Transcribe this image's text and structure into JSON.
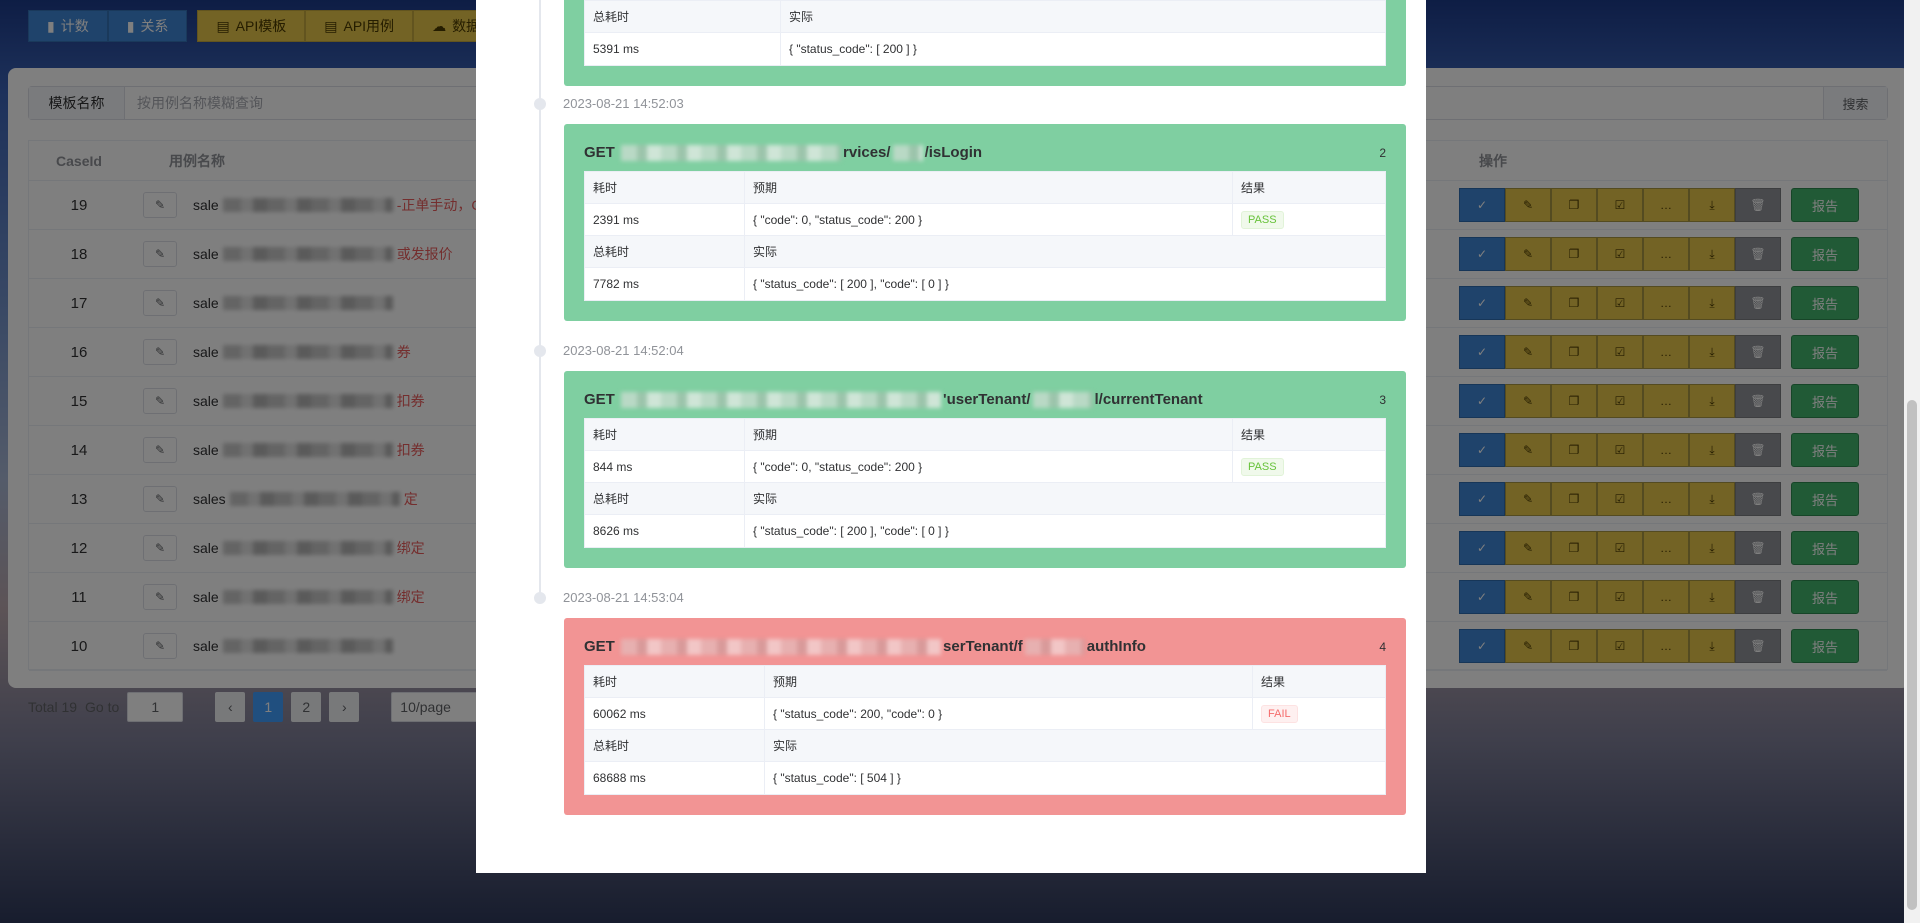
{
  "toolbar": {
    "count_label": "计数",
    "relation_label": "关系",
    "api_template_label": "API模板",
    "api_case_label": "API用例",
    "data_label": "数据上"
  },
  "search": {
    "label": "模板名称",
    "placeholder": "按用例名称模糊查询",
    "button": "搜索"
  },
  "table": {
    "headers": {
      "caseid": "CaseId",
      "name": "用例名称",
      "ops": "操作"
    },
    "rows": [
      {
        "id": "19",
        "prefix": "sale",
        "suffix": "-正单手动，CD"
      },
      {
        "id": "18",
        "prefix": "sale",
        "suffix": "或发报价"
      },
      {
        "id": "17",
        "prefix": "sale",
        "suffix": ""
      },
      {
        "id": "16",
        "prefix": "sale",
        "suffix": "券"
      },
      {
        "id": "15",
        "prefix": "sale",
        "suffix": "扣券"
      },
      {
        "id": "14",
        "prefix": "sale",
        "suffix": "扣券"
      },
      {
        "id": "13",
        "prefix": "sales",
        "suffix": "定"
      },
      {
        "id": "12",
        "prefix": "sale",
        "suffix": "绑定"
      },
      {
        "id": "11",
        "prefix": "sale",
        "suffix": "绑定"
      },
      {
        "id": "10",
        "prefix": "sale",
        "suffix": ""
      }
    ],
    "report_label": "报告"
  },
  "pager": {
    "total": "Total 19",
    "goto": "Go to",
    "goto_value": "1",
    "pages": [
      "1",
      "2"
    ],
    "active": "1",
    "size": "10/page"
  },
  "modal": {
    "top_step": {
      "total_label": "总耗时",
      "actual_label": "实际",
      "total": "5391 ms",
      "actual": "{ \"status_code\": [ 200 ] }"
    },
    "steps": [
      {
        "time": "2023-08-21 14:52:03",
        "method": "GET",
        "path_mid": "rvices/",
        "path_end": "/isLogin",
        "index": "2",
        "status": "pass",
        "cost_label": "耗时",
        "expect_label": "预期",
        "result_label": "结果",
        "cost": "2391 ms",
        "expect": "{ \"code\": 0, \"status_code\": 200 }",
        "result": "PASS",
        "total_label": "总耗时",
        "actual_label": "实际",
        "total": "7782 ms",
        "actual": "{ \"status_code\": [ 200 ], \"code\": [ 0 ] }"
      },
      {
        "time": "2023-08-21 14:52:04",
        "method": "GET",
        "path_mid": "'userTenant/",
        "path_end": "l/currentTenant",
        "index": "3",
        "status": "pass",
        "cost_label": "耗时",
        "expect_label": "预期",
        "result_label": "结果",
        "cost": "844 ms",
        "expect": "{ \"code\": 0, \"status_code\": 200 }",
        "result": "PASS",
        "total_label": "总耗时",
        "actual_label": "实际",
        "total": "8626 ms",
        "actual": "{ \"status_code\": [ 200 ], \"code\": [ 0 ] }"
      },
      {
        "time": "2023-08-21 14:53:04",
        "method": "GET",
        "path_mid": "serTenant/f",
        "path_end": "authInfo",
        "index": "4",
        "status": "fail",
        "cost_label": "耗时",
        "expect_label": "预期",
        "result_label": "结果",
        "cost": "60062 ms",
        "expect": "{ \"status_code\": 200, \"code\": 0 }",
        "result": "FAIL",
        "total_label": "总耗时",
        "actual_label": "实际",
        "total": "68688 ms",
        "actual": "{ \"status_code\": [ 504 ] }"
      }
    ]
  },
  "colors": {
    "pass_bg": "#7fcfa1",
    "fail_bg": "#f29494",
    "accent": "#409eff"
  }
}
